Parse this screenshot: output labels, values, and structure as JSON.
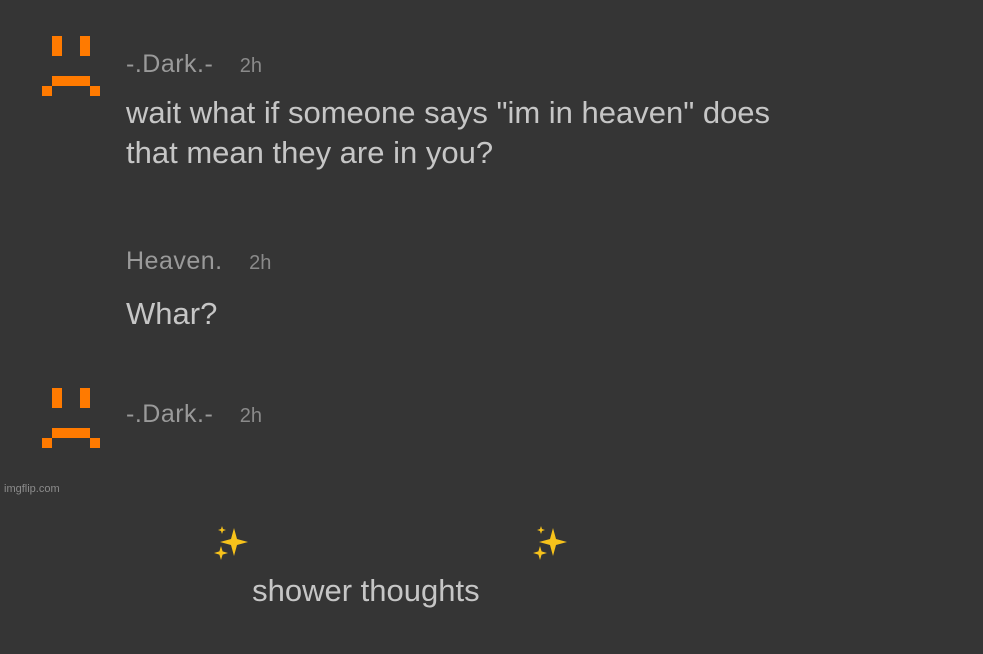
{
  "colors": {
    "background": "#353535",
    "avatar_orange": "#ff7a00",
    "username": "#9a9a9a",
    "body_text": "#c6c6c6"
  },
  "messages": [
    {
      "avatar_icon": "sad-face-icon",
      "username": "-.Dark.-",
      "time": "2h",
      "text": "wait what if someone says \"im in heaven\" does\nthat mean they are in you?"
    },
    {
      "username": "Heaven.",
      "time": "2h",
      "text": "Whar?"
    },
    {
      "avatar_icon": "sad-face-icon",
      "username": "-.Dark.-",
      "time": "2h",
      "text_prefix_icon": "sparkles-icon",
      "text": "shower thoughts",
      "text_suffix_icon": "sparkles-icon"
    }
  ],
  "watermark": "imgflip.com"
}
